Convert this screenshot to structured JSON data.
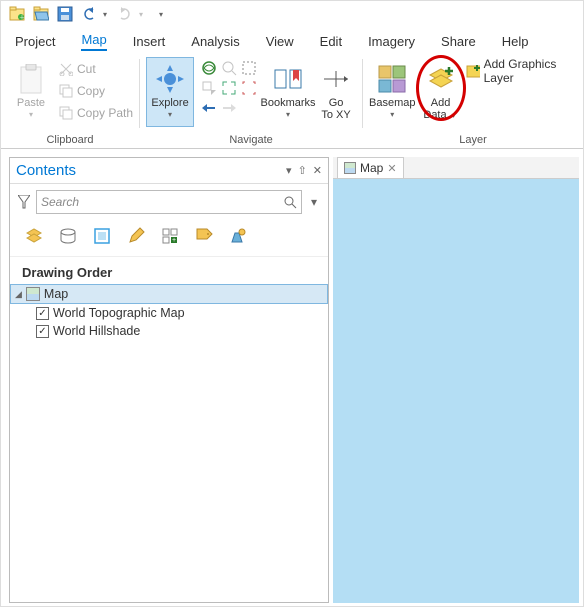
{
  "menu": {
    "project": "Project",
    "map": "Map",
    "insert": "Insert",
    "analysis": "Analysis",
    "view": "View",
    "edit": "Edit",
    "imagery": "Imagery",
    "share": "Share",
    "help": "Help"
  },
  "ribbon": {
    "clipboard": {
      "paste": "Paste",
      "cut": "Cut",
      "copy": "Copy",
      "copypath": "Copy Path",
      "title": "Clipboard"
    },
    "navigate": {
      "explore": "Explore",
      "bookmarks": "Bookmarks",
      "goto_l1": "Go",
      "goto_l2": "To XY",
      "title": "Navigate"
    },
    "layer": {
      "basemap": "Basemap",
      "adddata_l1": "Add",
      "adddata_l2": "Data",
      "addgraphics": "Add Graphics Layer",
      "title": "Layer"
    }
  },
  "contents": {
    "title": "Contents",
    "search_placeholder": "Search",
    "drawing_order": "Drawing Order",
    "map_node": "Map",
    "layer1": "World Topographic Map",
    "layer2": "World Hillshade"
  },
  "maptab": {
    "label": "Map"
  }
}
